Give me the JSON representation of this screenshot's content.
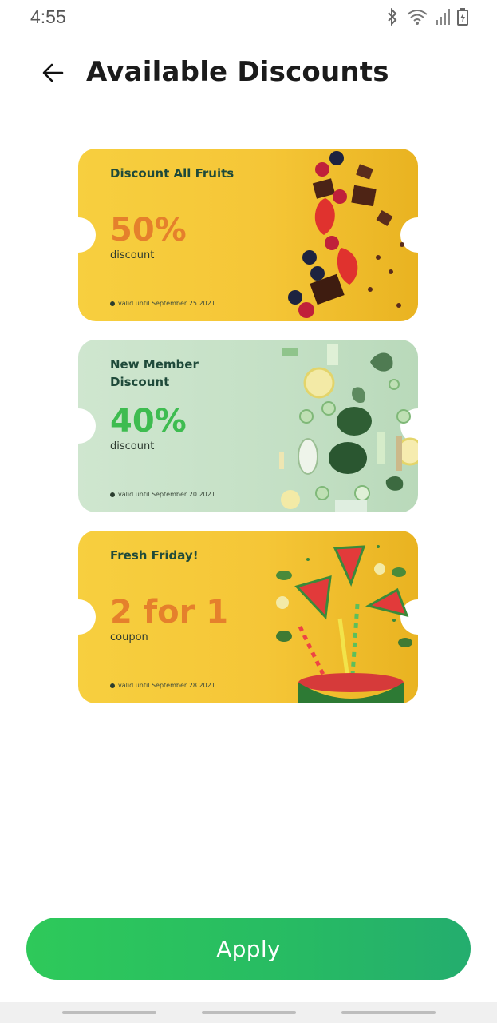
{
  "status": {
    "time": "4:55"
  },
  "header": {
    "title": "Available Discounts"
  },
  "coupons": [
    {
      "title": "Discount All Fruits",
      "value": "50%",
      "sub": "discount",
      "valid": "valid until September 25 2021",
      "theme": "yellow",
      "art": "berries-brownie"
    },
    {
      "title": "New Member Discount",
      "value": "40%",
      "sub": "discount",
      "valid": "valid until September 20 2021",
      "theme": "green",
      "art": "green-vegetables"
    },
    {
      "title": "Fresh Friday!",
      "value": "2 for 1",
      "sub": "coupon",
      "valid": "valid until September 28 2021",
      "theme": "yellow",
      "art": "watermelon"
    }
  ],
  "apply_label": "Apply",
  "colors": {
    "accent": "#2ec95a",
    "yellow": "#f7cf3f",
    "green_bg": "#c9e3ca",
    "orange_value": "#e5802c",
    "green_value": "#3ebc50"
  }
}
